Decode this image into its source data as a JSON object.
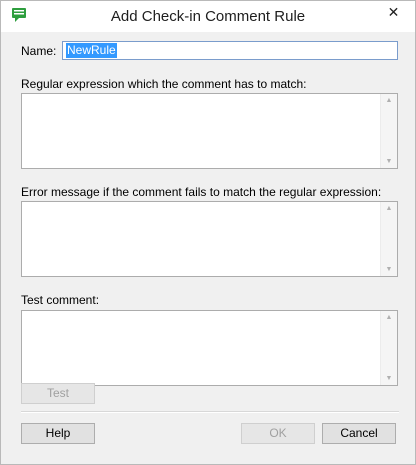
{
  "window": {
    "title": "Add Check-in Comment Rule",
    "icon": "comment-icon",
    "close_glyph": "✕"
  },
  "form": {
    "name_label": "Name:",
    "name_value": "NewRule",
    "regex_label": "Regular expression which the comment has to match:",
    "regex_value": "",
    "error_label": "Error message if the comment fails to match the regular expression:",
    "error_value": "",
    "test_label": "Test comment:",
    "test_value": ""
  },
  "buttons": {
    "test": "Test",
    "help": "Help",
    "ok": "OK",
    "cancel": "Cancel"
  },
  "scroll_glyphs": {
    "up": "▲",
    "down": "▼"
  },
  "colors": {
    "selection": "#3399ff",
    "focus_border": "#7a9ccc",
    "dialog_bg": "#f0f0f0",
    "icon_green": "#2e9e3e"
  }
}
